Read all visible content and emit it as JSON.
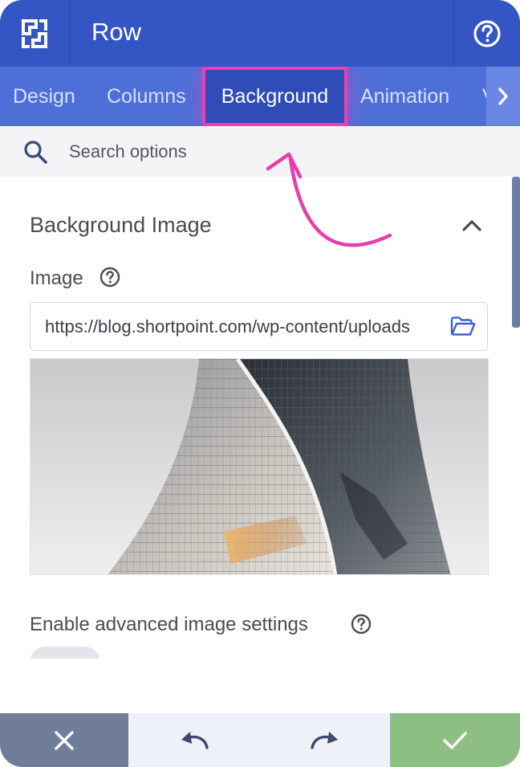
{
  "header": {
    "title": "Row",
    "logo_icon": "shortpoint-logo-icon",
    "help_icon": "help-circle-icon"
  },
  "tabs": [
    {
      "label": "Design",
      "active": false
    },
    {
      "label": "Columns",
      "active": false
    },
    {
      "label": "Background",
      "active": true
    },
    {
      "label": "Animation",
      "active": false
    },
    {
      "label": "V",
      "active": false
    }
  ],
  "search": {
    "placeholder": "Search options",
    "value": ""
  },
  "section": {
    "title": "Background Image",
    "image_label": "Image",
    "image_url": "https://blog.shortpoint.com/wp-content/uploads",
    "advanced_label": "Enable advanced image settings"
  },
  "colors": {
    "header": "#3455c4",
    "tabs": "#4f6fd8",
    "highlight": "#ec3fb0",
    "cancel": "#6f7d98",
    "confirm": "#8dbf84"
  },
  "footer": {
    "cancel_icon": "close-icon",
    "undo_icon": "undo-icon",
    "redo_icon": "redo-icon",
    "confirm_icon": "check-icon"
  }
}
